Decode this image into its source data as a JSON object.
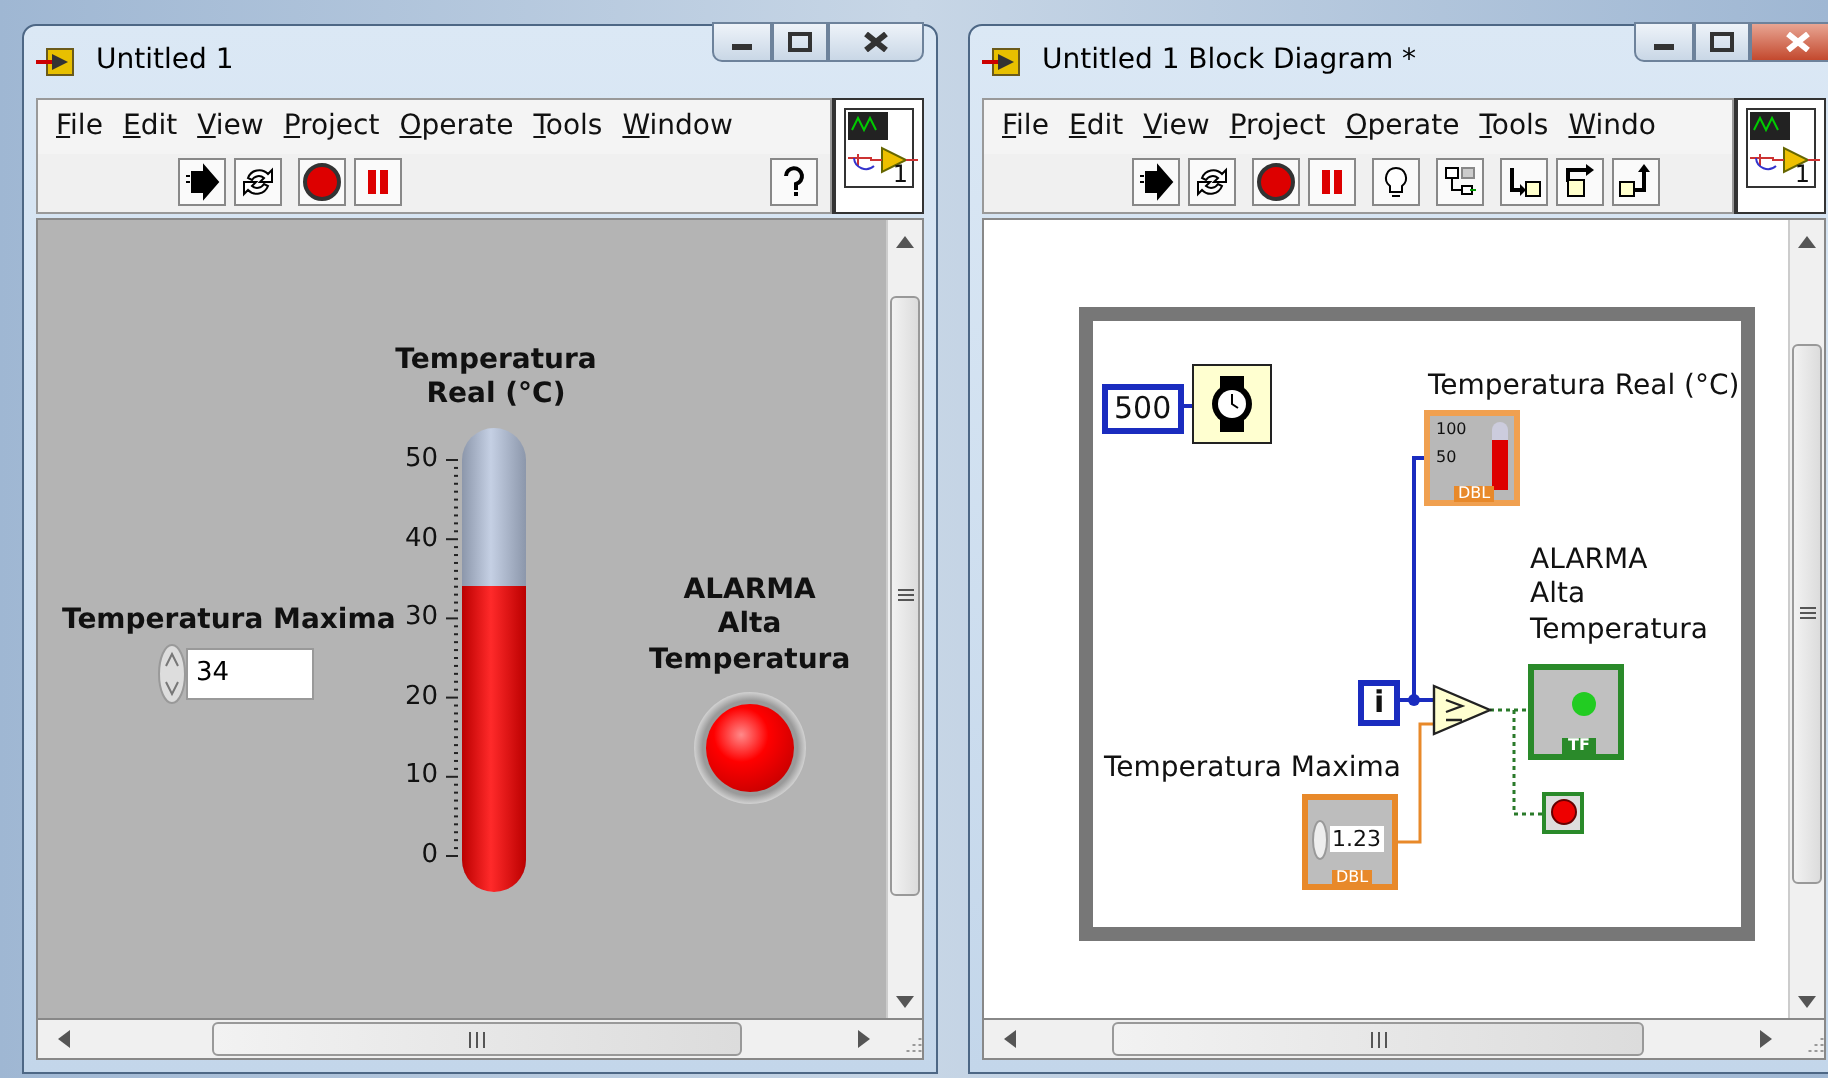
{
  "windows": [
    {
      "kind": "front_panel",
      "title": "Untitled 1",
      "menu": [
        "File",
        "Edit",
        "View",
        "Project",
        "Operate",
        "Tools",
        "Window"
      ],
      "toolbar": [
        {
          "kind": "run"
        },
        {
          "kind": "run_continuously"
        },
        {
          "kind": "abort"
        },
        {
          "kind": "pause"
        },
        {
          "kind": "help"
        }
      ],
      "icon_number": "1",
      "panel": {
        "numeric": {
          "label": "Temperatura Maxima",
          "value": "34"
        },
        "thermometer": {
          "label": "Temperatura Real (°C)",
          "scale": [
            "50",
            "40",
            "30",
            "20",
            "10",
            "0"
          ],
          "level": 0.68
        },
        "led": {
          "label": "ALARMA Alta Temperatura",
          "on": true
        }
      }
    },
    {
      "kind": "block_diagram",
      "title": "Untitled 1 Block Diagram *",
      "menu": [
        "File",
        "Edit",
        "View",
        "Project",
        "Operate",
        "Tools",
        "Windo"
      ],
      "toolbar": [
        {
          "kind": "run"
        },
        {
          "kind": "run_continuously"
        },
        {
          "kind": "abort"
        },
        {
          "kind": "pause"
        },
        {
          "kind": "highlight"
        },
        {
          "kind": "retain"
        },
        {
          "kind": "step_into"
        },
        {
          "kind": "step_over"
        },
        {
          "kind": "step_out"
        }
      ],
      "icon_number": "1",
      "diagram": {
        "wait_constant": "500",
        "loop_index": "i",
        "thermometer_terminal": {
          "label": "Temperatura Real (°C)",
          "scale": [
            "100",
            "50"
          ],
          "type": "DBL"
        },
        "led_terminal": {
          "label": "ALARMA Alta Temperatura",
          "type": "TF"
        },
        "numeric_terminal": {
          "label": "Temperatura Maxima",
          "value": "1.23",
          "type": "DBL"
        }
      }
    }
  ]
}
